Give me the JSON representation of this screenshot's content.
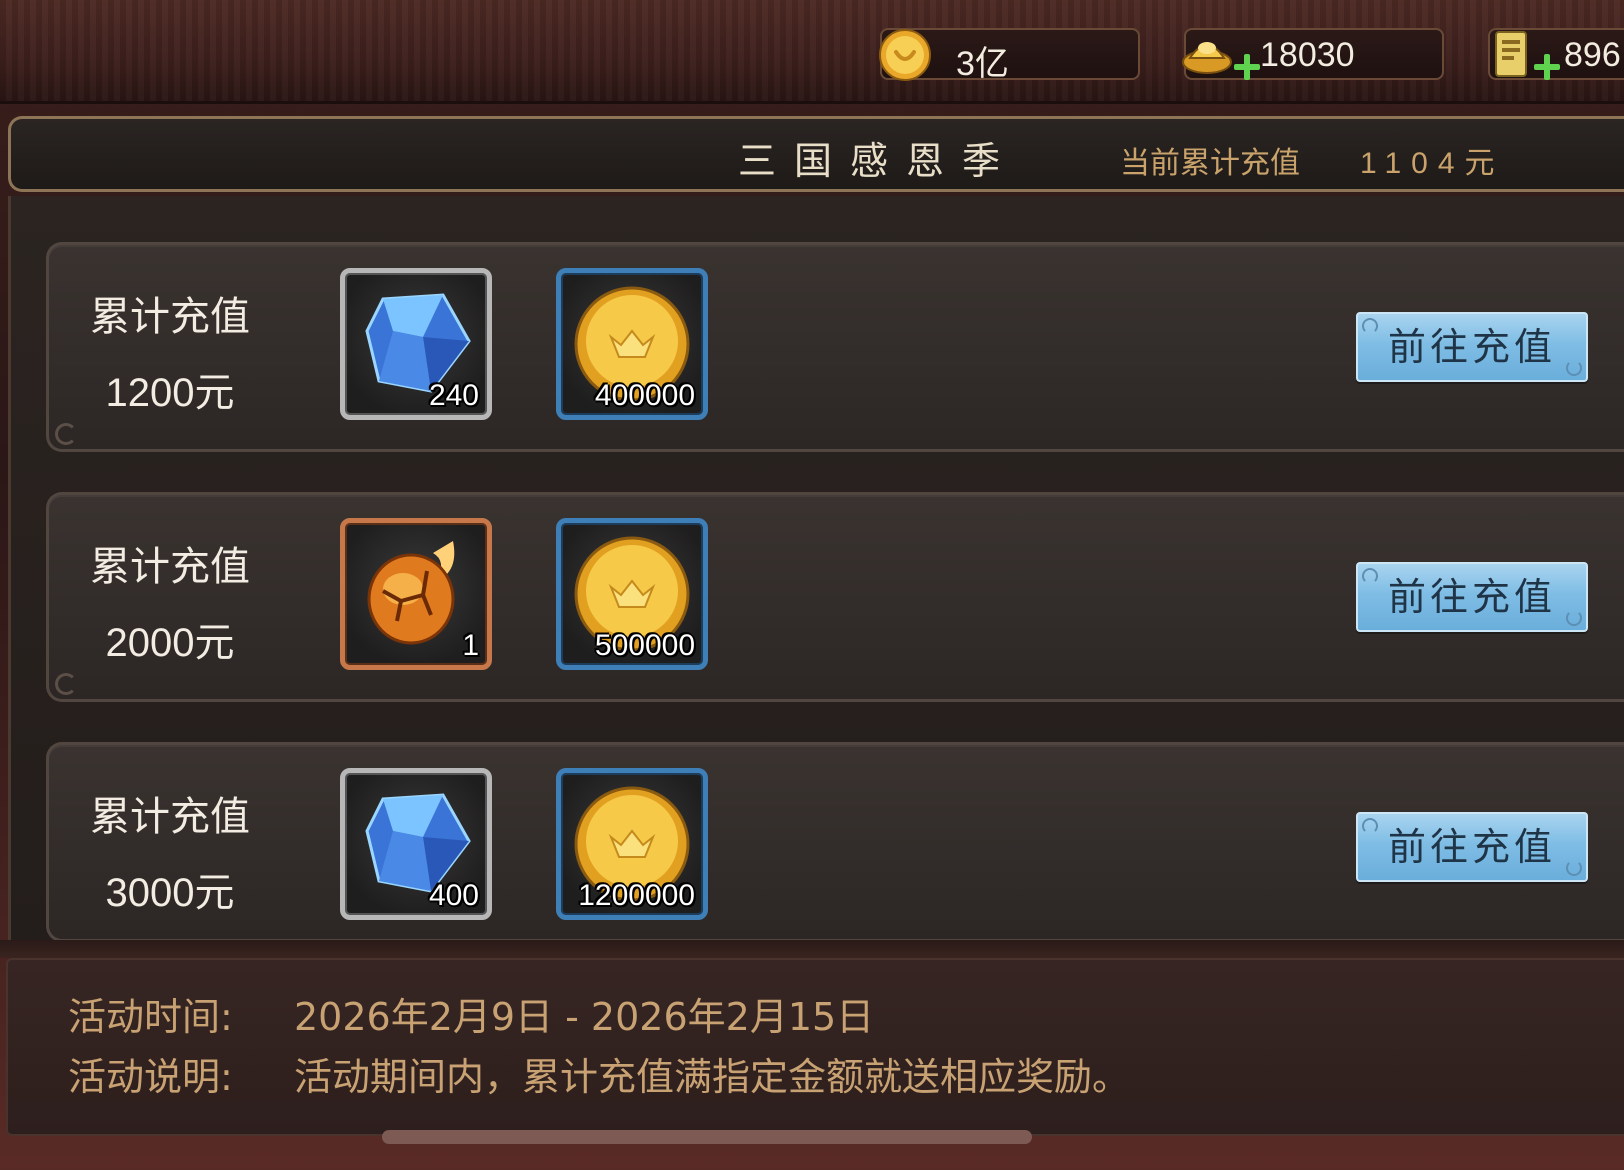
{
  "resources": [
    {
      "icon": "gold-coin-icon",
      "value": "3亿"
    },
    {
      "icon": "gold-ingot-icon",
      "value": "18030"
    },
    {
      "icon": "scroll-ticket-icon",
      "value": "896"
    }
  ],
  "banner": {
    "title": "三国感恩季",
    "total_label": "当前累计充值",
    "total_value": "1104元"
  },
  "tiers": [
    {
      "label": "累计充值",
      "amount": "1200元",
      "rewards": [
        {
          "icon": "blue-crystal-icon",
          "qty": "240"
        },
        {
          "icon": "gold-coin-icon",
          "qty": "400000"
        }
      ],
      "button": "前往充值"
    },
    {
      "label": "累计充值",
      "amount": "2000元",
      "rewards": [
        {
          "icon": "flaming-egg-icon",
          "qty": "1"
        },
        {
          "icon": "gold-coin-icon",
          "qty": "500000"
        }
      ],
      "button": "前往充值"
    },
    {
      "label": "累计充值",
      "amount": "3000元",
      "rewards": [
        {
          "icon": "blue-crystal-icon",
          "qty": "400"
        },
        {
          "icon": "gold-coin-icon",
          "qty": "1200000"
        }
      ],
      "button": "前往充值"
    }
  ],
  "info": {
    "time_label": "活动时间:",
    "time_value": "2026年2月9日 - 2026年2月15日",
    "desc_label": "活动说明:",
    "desc_value": "活动期间内，累计充值满指定金额就送相应奖励。"
  },
  "colors": {
    "accent_gold": "#c9a273",
    "button_blue": "#7fbde5",
    "plus_green": "#5fd24f"
  }
}
